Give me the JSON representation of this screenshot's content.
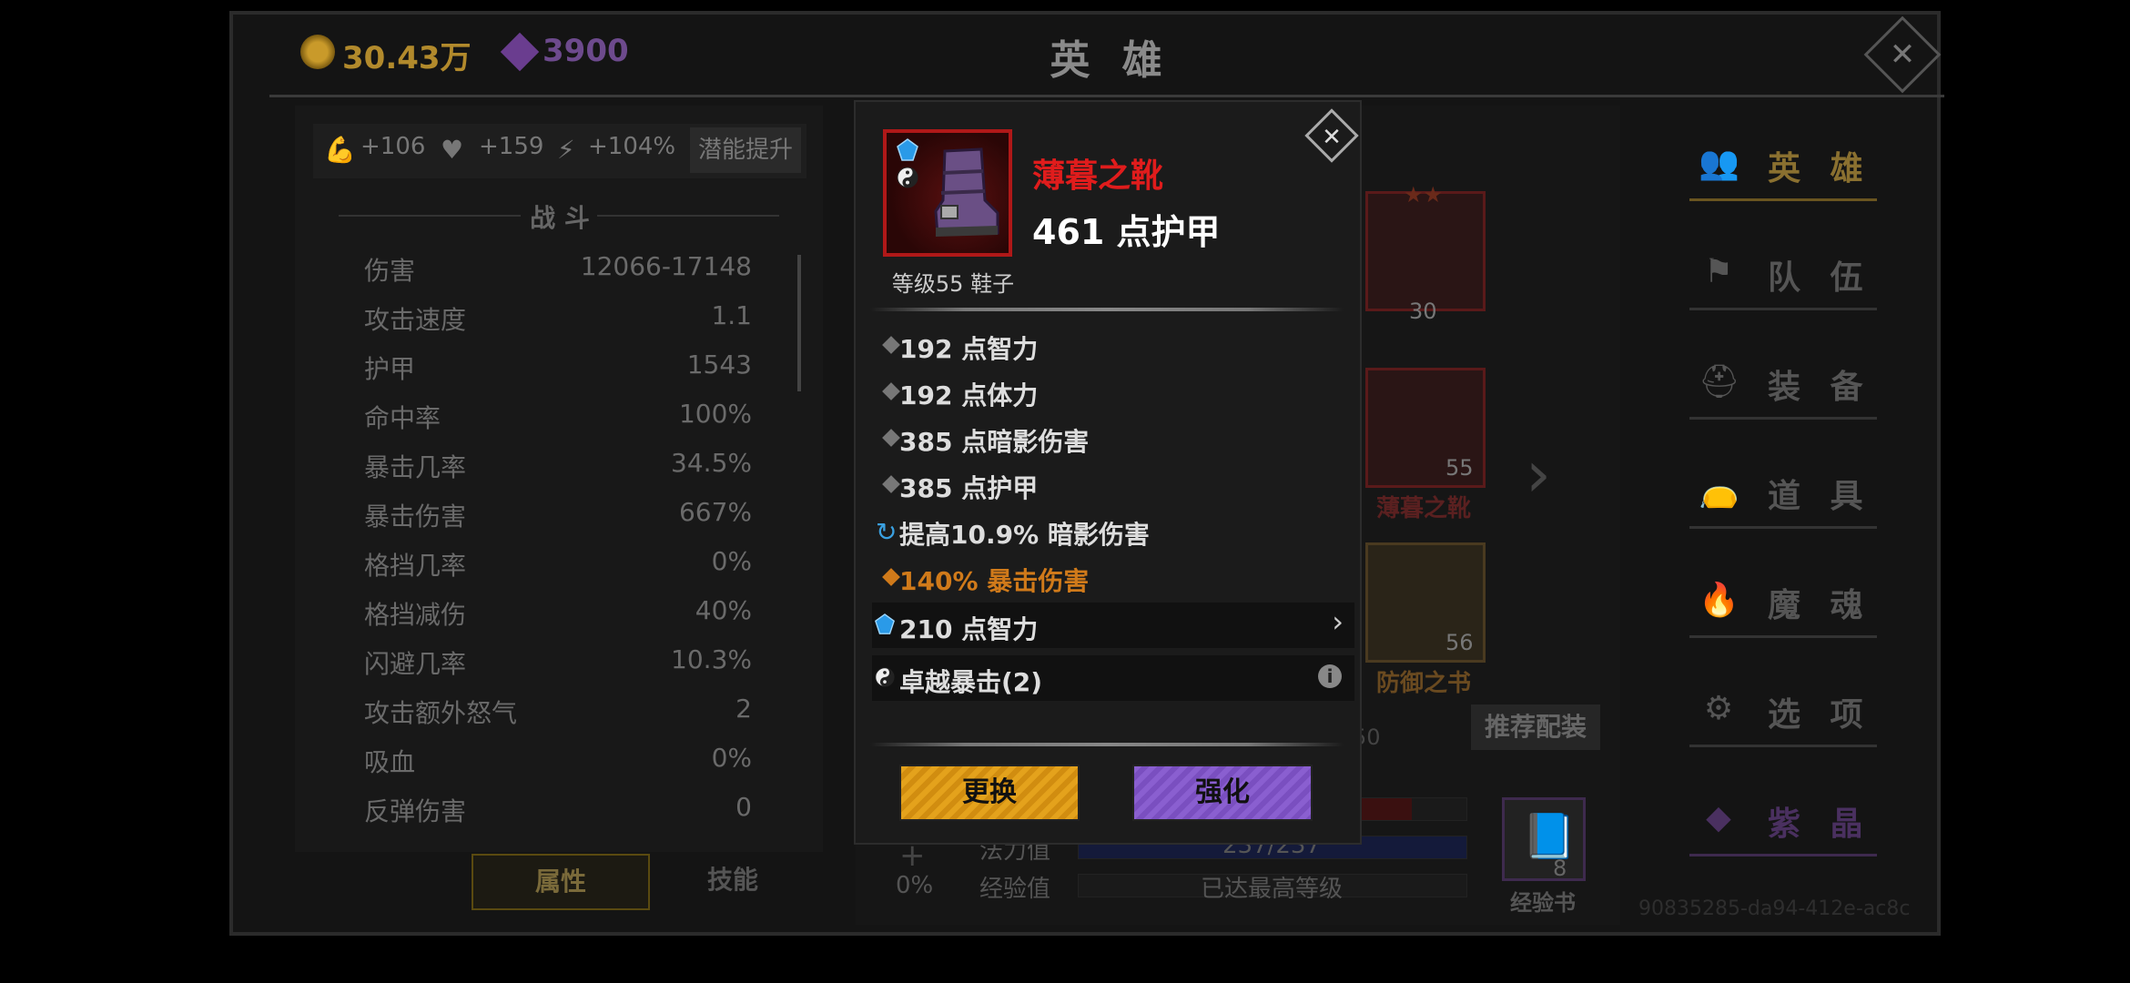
{
  "header": {
    "gold": "30.43万",
    "gems": "3900",
    "title": "英 雄"
  },
  "buffs": {
    "strength": "+106",
    "health": "+159",
    "speed": "+104%",
    "potential_button": "潜能提升"
  },
  "combat": {
    "section_title": "战 斗",
    "stats": [
      {
        "label": "伤害",
        "value": "12066-17148"
      },
      {
        "label": "攻击速度",
        "value": "1.1"
      },
      {
        "label": "护甲",
        "value": "1543"
      },
      {
        "label": "命中率",
        "value": "100%"
      },
      {
        "label": "暴击几率",
        "value": "34.5%"
      },
      {
        "label": "暴击伤害",
        "value": "667%"
      },
      {
        "label": "格挡几率",
        "value": "0%"
      },
      {
        "label": "格挡减伤",
        "value": "40%"
      },
      {
        "label": "闪避几率",
        "value": "10.3%"
      },
      {
        "label": "攻击额外怒气",
        "value": "2"
      },
      {
        "label": "吸血",
        "value": "0%"
      },
      {
        "label": "反弹伤害",
        "value": "0"
      }
    ]
  },
  "tabs": {
    "attributes": "属性",
    "skills": "技能"
  },
  "equipment": {
    "slot1_num": "30",
    "slot2_num": "55",
    "slot2_name": "薄暮之靴",
    "slot3_num": "56",
    "slot3_name": "防御之书",
    "partial_text": "50",
    "recommend_button": "推荐配装",
    "left_pct": "0%",
    "mana_label": "法力值",
    "mana_value": "237/237",
    "xp_label": "经验值",
    "xp_value": "已达最高等级",
    "xp_book_count": "8",
    "xp_book_label": "经验书"
  },
  "nav": [
    {
      "label": "英 雄",
      "icon": "heroes-icon"
    },
    {
      "label": "队 伍",
      "icon": "flag-icon"
    },
    {
      "label": "装 备",
      "icon": "helmet-icon"
    },
    {
      "label": "道 具",
      "icon": "bag-icon"
    },
    {
      "label": "魔 魂",
      "icon": "flame-icon"
    },
    {
      "label": "选 项",
      "icon": "gear-icon"
    },
    {
      "label": "紫 晶",
      "icon": "amethyst-icon"
    }
  ],
  "uuid": "90835285-da94-412e-ac8c",
  "item": {
    "name": "薄暮之靴",
    "main_stat": "461 点护甲",
    "level": "等级55 鞋子",
    "stats": [
      "192 点智力",
      "192 点体力",
      "385 点暗影伤害",
      "385 点护甲"
    ],
    "special": "提高10.9% 暗影伤害",
    "legendary": "140% 暴击伤害",
    "socket": "210 点智力",
    "set_bonus": "卓越暴击(2)",
    "replace_button": "更换",
    "enhance_button": "强化"
  },
  "colors": {
    "item_name": "#e01c1c",
    "legendary": "#d07a1a",
    "replace_btn": "#e4a21c",
    "enhance_btn": "#8a5fd0"
  }
}
